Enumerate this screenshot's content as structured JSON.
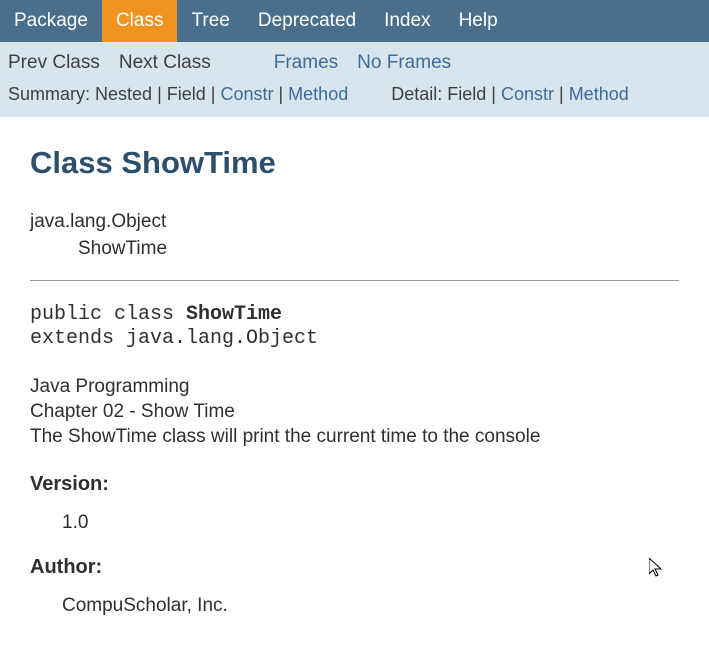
{
  "topnav": {
    "package": "Package",
    "class": "Class",
    "tree": "Tree",
    "deprecated": "Deprecated",
    "index": "Index",
    "help": "Help"
  },
  "subnav": {
    "prev_class": "Prev Class",
    "next_class": "Next Class",
    "frames": "Frames",
    "no_frames": "No Frames",
    "summary_label": "Summary:",
    "summary_nested": "Nested",
    "summary_field": "Field",
    "summary_constr": "Constr",
    "summary_method": "Method",
    "detail_label": "Detail:",
    "detail_field": "Field",
    "detail_constr": "Constr",
    "detail_method": "Method"
  },
  "title": "Class ShowTime",
  "inheritance": {
    "parent": "java.lang.Object",
    "child": "ShowTime"
  },
  "signature": {
    "prefix": "public class ",
    "classname": "ShowTime",
    "extends_line": "extends java.lang.Object"
  },
  "description": {
    "line1": "Java Programming",
    "line2": "Chapter 02 - Show Time",
    "line3": "The ShowTime class will print the current time to the console"
  },
  "version_label": "Version:",
  "version_value": "1.0",
  "author_label": "Author:",
  "author_value": "CompuScholar, Inc."
}
